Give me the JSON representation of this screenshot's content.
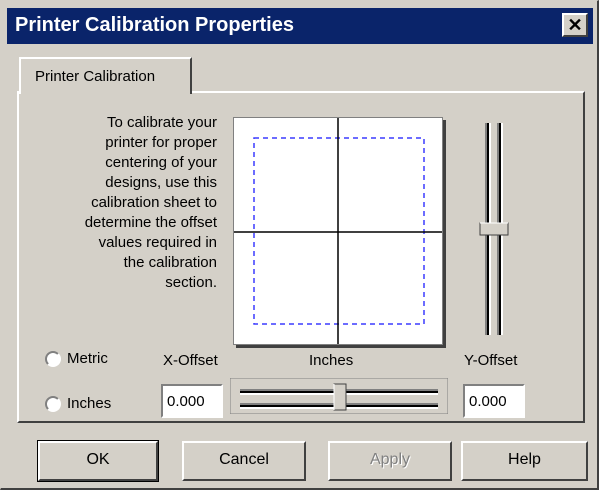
{
  "window": {
    "title": "Printer Calibration Properties",
    "close_icon": "close-icon"
  },
  "tab": {
    "label": "Printer Calibration"
  },
  "description": [
    "To calibrate your",
    "printer for proper",
    "centering of your",
    "designs, use this",
    "calibration sheet to",
    "determine the offset",
    "values required in",
    "the calibration",
    "section."
  ],
  "units": {
    "metric_label": "Metric",
    "inches_label": "Inches",
    "selected": "none"
  },
  "offsets": {
    "x_label": "X-Offset",
    "unit_label": "Inches",
    "y_label": "Y-Offset",
    "x_value": "0.000",
    "y_value": "0.000"
  },
  "buttons": {
    "ok": "OK",
    "cancel": "Cancel",
    "apply": "Apply",
    "help": "Help"
  },
  "colors": {
    "titlebar": "#0a246a",
    "face": "#d4d0c8",
    "guide_dashes": "#3c3cff"
  }
}
